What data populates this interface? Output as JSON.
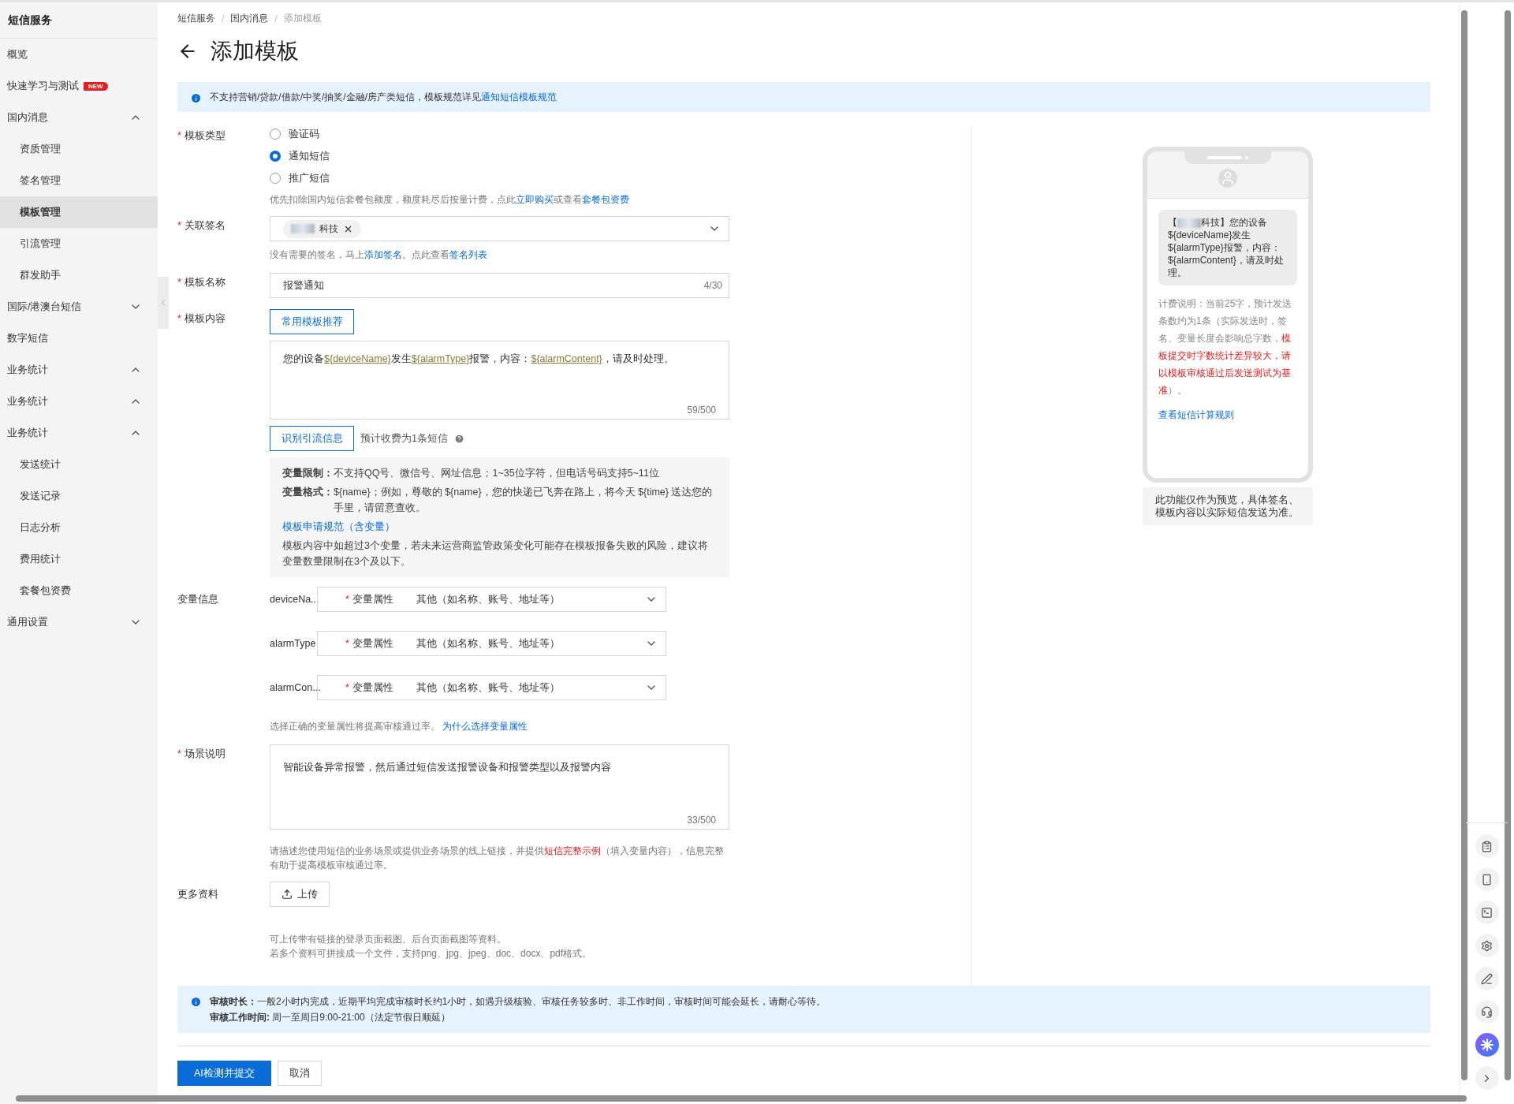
{
  "sidebar": {
    "title": "短信服务",
    "items": [
      {
        "kind": "link",
        "label": "概览",
        "selected": false
      },
      {
        "kind": "link",
        "label": "快速学习与测试",
        "badge": "NEW",
        "selected": false
      },
      {
        "kind": "group",
        "label": "国内消息",
        "expanded": true,
        "children": [
          {
            "label": "资质管理",
            "selected": false
          },
          {
            "label": "签名管理",
            "selected": false
          },
          {
            "label": "模板管理",
            "selected": true
          },
          {
            "label": "引流管理",
            "selected": false
          },
          {
            "label": "群发助手",
            "selected": false
          }
        ]
      },
      {
        "kind": "group",
        "label": "国际/港澳台短信",
        "expanded": false
      },
      {
        "kind": "link",
        "label": "数字短信",
        "selected": false
      },
      {
        "kind": "group",
        "label": "业务统计",
        "expanded": true
      },
      {
        "kind": "group",
        "label": "业务统计",
        "expanded": true
      },
      {
        "kind": "group",
        "label": "业务统计",
        "expanded": true,
        "children": [
          {
            "label": "发送统计",
            "selected": false
          },
          {
            "label": "发送记录",
            "selected": false
          },
          {
            "label": "日志分析",
            "selected": false
          },
          {
            "label": "费用统计",
            "selected": false
          },
          {
            "label": "套餐包资费",
            "selected": false
          }
        ]
      },
      {
        "kind": "group",
        "label": "通用设置",
        "expanded": false
      }
    ]
  },
  "breadcrumb": [
    {
      "kind": "item",
      "text": "短信服务"
    },
    {
      "kind": "sep",
      "text": "/"
    },
    {
      "kind": "item",
      "text": "国内消息"
    },
    {
      "kind": "sep",
      "text": "/"
    },
    {
      "kind": "current",
      "text": "添加模板"
    }
  ],
  "title": "添加模板",
  "notice": [
    {
      "kind": "text",
      "text": "不支持营销/贷款/借款/中奖/抽奖/金融/房产类短信，模板规范详见"
    },
    {
      "kind": "link",
      "text": "通知短信模板规范"
    }
  ],
  "form": {
    "type": {
      "label": "模板类型",
      "required": "*",
      "options": [
        {
          "label": "验证码",
          "selected": false
        },
        {
          "label": "通知短信",
          "selected": true
        },
        {
          "label": "推广短信",
          "selected": false
        }
      ],
      "hint": [
        {
          "kind": "text",
          "text": "优先扣除国内短信套餐包额度，额度耗尽后按量计费，点此"
        },
        {
          "kind": "link",
          "text": "立即购买"
        },
        {
          "kind": "text",
          "text": "或查看"
        },
        {
          "kind": "link",
          "text": "套餐包资费"
        }
      ]
    },
    "signature": {
      "label": "关联签名",
      "required": "*",
      "tag": "科技",
      "hint": [
        {
          "kind": "text",
          "text": "没有需要的签名，马上"
        },
        {
          "kind": "link",
          "text": "添加签名"
        },
        {
          "kind": "text",
          "text": "。点此查看"
        },
        {
          "kind": "link",
          "text": "签名列表"
        }
      ]
    },
    "name": {
      "label": "模板名称",
      "required": "*",
      "value": "报警通知",
      "count": "4/30"
    },
    "content": {
      "label": "模板内容",
      "required": "*",
      "recommend_button": "常用模板推荐",
      "segments": [
        {
          "kind": "text",
          "text": "您的设备"
        },
        {
          "kind": "var",
          "text": "${deviceName}"
        },
        {
          "kind": "text",
          "text": "发生"
        },
        {
          "kind": "var",
          "text": "${alarmType}"
        },
        {
          "kind": "text",
          "text": "报警，内容："
        },
        {
          "kind": "var",
          "text": "${alarmContent}"
        },
        {
          "kind": "text",
          "text": "，请及时处理。"
        }
      ],
      "count": "59/500",
      "detect_button": "识别引流信息",
      "fee": "预计收费为1条短信",
      "rules": [
        {
          "kind": "rule",
          "text": "**变量限制：**不支持QQ号、微信号、网址信息；1~35位字符，但电话号码支持5~11位"
        },
        {
          "kind": "rule",
          "text": "**变量格式：**${name}；例如，尊敬的 ${name}，您的快递已飞奔在路上，将今天 ${time} 送达您的手里，请留意查收。"
        },
        {
          "kind": "link",
          "text": "模板申请规范（含变量）"
        },
        {
          "kind": "text",
          "text": "模板内容中如超过3个变量，若未来运营商监管政策变化可能存在模板报备失败的风险，建议将变量数量限制在3个及以下。"
        }
      ]
    },
    "variables": {
      "label": "变量信息",
      "rows": [
        {
          "name": "deviceNa...",
          "required": "*",
          "attr_label": "变量属性",
          "value": "其他（如名称、账号、地址等）"
        },
        {
          "name": "alarmType",
          "required": "*",
          "attr_label": "变量属性",
          "value": "其他（如名称、账号、地址等）"
        },
        {
          "name": "alarmCon...",
          "required": "*",
          "attr_label": "变量属性",
          "value": "其他（如名称、账号、地址等）"
        }
      ],
      "hint": [
        {
          "kind": "text",
          "text": "选择正确的变量属性将提高审核通过率。 "
        },
        {
          "kind": "link",
          "text": "为什么选择变量属性"
        }
      ]
    },
    "scene": {
      "label": "场景说明",
      "required": "*",
      "value": "智能设备异常报警，然后通过短信发送报警设备和报警类型以及报警内容",
      "count": "33/500",
      "hint": [
        {
          "kind": "text",
          "text": "请描述您使用短信的业务场景或提供业务场景的线上链接，并提供"
        },
        {
          "kind": "warn",
          "text": "短信完整示例"
        },
        {
          "kind": "text",
          "text": "（填入变量内容），信息完整有助于提高模板审核通过率。"
        }
      ]
    },
    "upload": {
      "label": "更多资料",
      "button": "上传",
      "hints": [
        "可上传带有链接的登录页面截图、后台页面截图等资料。",
        "若多个资料可拼接成一个文件，支持png、jpg、jpeg、doc、docx、pdf格式。"
      ]
    }
  },
  "review": [
    "**审核时长：**一般2小时内完成，近期平均完成审核时长约1小时，如遇升级核验、审核任务较多时、非工作时间，审核时间可能会延长，请耐心等待。",
    "**审核工作时间:** 周一至周日9:00-21:00（法定节假日顺延）"
  ],
  "actions": [
    {
      "kind": "primary",
      "label": "AI检测并提交"
    },
    {
      "kind": "secondary",
      "label": "取消"
    }
  ],
  "preview": {
    "bubble": [
      {
        "kind": "text",
        "text": "【"
      },
      {
        "kind": "redacted"
      },
      {
        "kind": "text",
        "text": "科技】您的设备${deviceName}发生${alarmType}报警，内容：${alarmContent}，请及时处理。"
      }
    ],
    "billing": [
      {
        "kind": "text",
        "text": "计费说明：当前25字，预计发送条数约为1条（实际发送时，签名、变量长度会影响总字数，"
      },
      {
        "kind": "warn",
        "text": "模板提交时字数统计差异较大，请以模板审核通过后发送测试为基准"
      },
      {
        "kind": "text",
        "text": "）。"
      }
    ],
    "rule_link": "查看短信计算规则",
    "disclaimer": "此功能仅作为预览，具体签名、模板内容以实际短信发送为准。"
  }
}
